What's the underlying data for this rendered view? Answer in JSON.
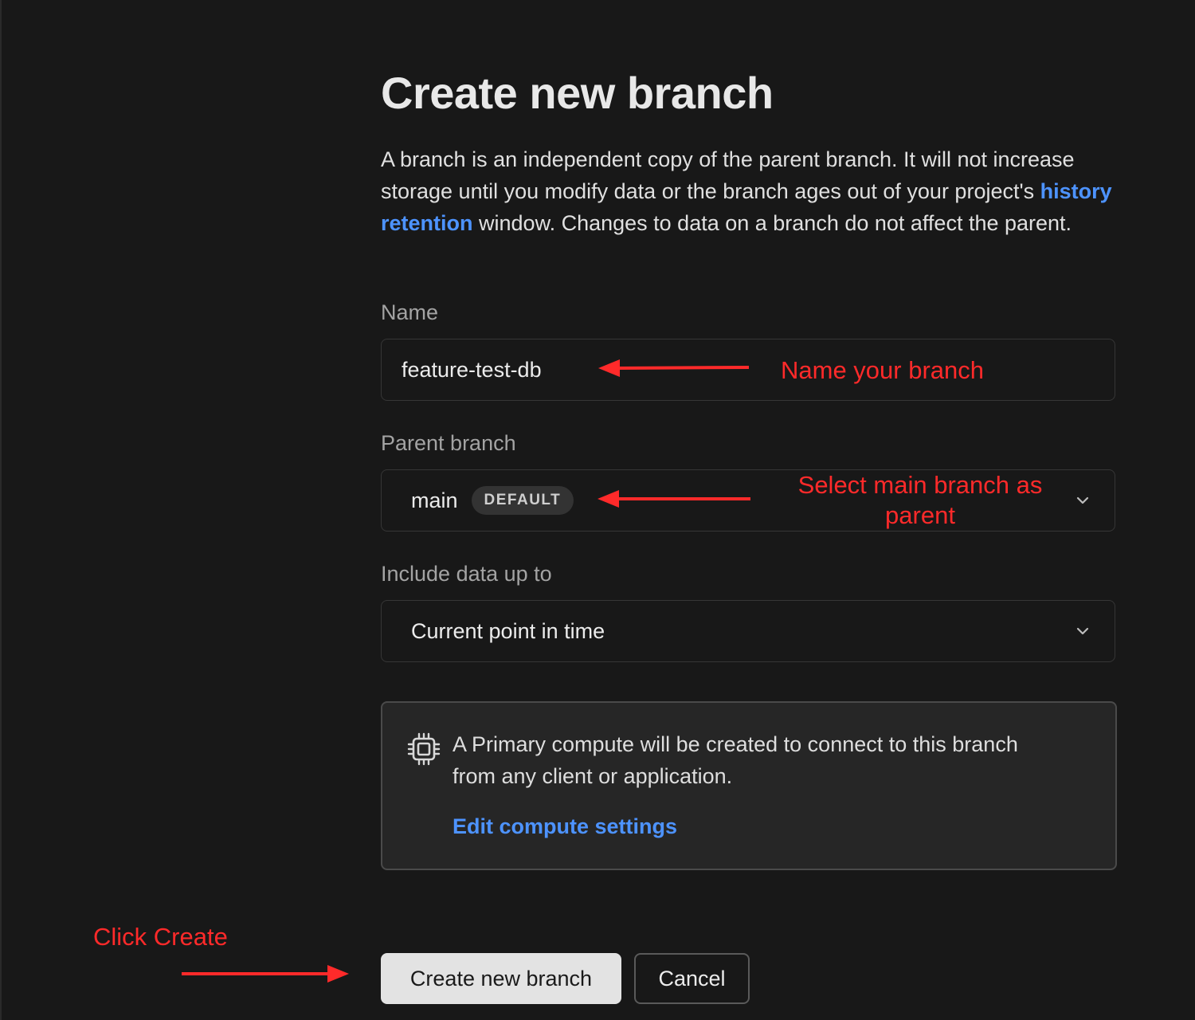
{
  "page": {
    "title": "Create new branch",
    "description": {
      "before_link": "A branch is an independent copy of the parent branch. It will not increase storage until you modify data or the branch ages out of your project's ",
      "link": "history retention",
      "after_link": " window. Changes to data on a branch do not affect the parent."
    }
  },
  "form": {
    "name": {
      "label": "Name",
      "value": "feature-test-db"
    },
    "parent_branch": {
      "label": "Parent branch",
      "value": "main",
      "badge": "DEFAULT",
      "icon": "chevron-down-icon"
    },
    "include_data": {
      "label": "Include data up to",
      "value": "Current point in time",
      "icon": "chevron-down-icon"
    }
  },
  "compute_info": {
    "icon": "cpu-chip-icon",
    "text": "A Primary compute will be created to connect to this branch from any client or application.",
    "link": "Edit compute settings"
  },
  "actions": {
    "create_label": "Create new branch",
    "cancel_label": "Cancel"
  },
  "annotations": {
    "name_hint": "Name your branch",
    "parent_hint": "Select main branch as parent",
    "create_hint": "Click Create",
    "color": "#ff2a2a"
  },
  "colors": {
    "background": "#181818",
    "link": "#4d93ff",
    "primary_button": "#e3e3e3",
    "annotation": "#ff2a2a"
  }
}
